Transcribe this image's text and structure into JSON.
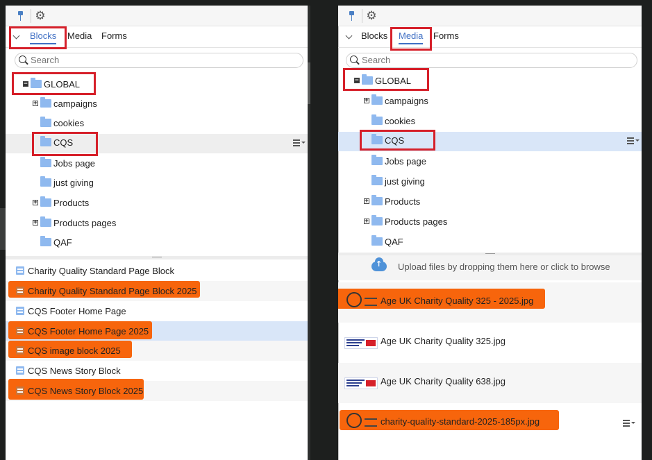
{
  "left": {
    "tabs": [
      "Blocks",
      "Media",
      "Forms"
    ],
    "search_placeholder": "Search",
    "tree": {
      "root": "GLOBAL",
      "items": [
        "campaigns",
        "cookies",
        "CQS",
        "Jobs page",
        "just giving",
        "Products",
        "Products pages",
        "QAF"
      ]
    },
    "blocks": [
      "Charity Quality Standard Page Block",
      "Charity Quality Standard Page Block 2025",
      "CQS Footer Home Page",
      "CQS Footer Home Page 2025",
      "CQS image block 2025",
      "CQS News Story Block",
      "CQS News Story Block 2025"
    ]
  },
  "right": {
    "tabs": [
      "Blocks",
      "Media",
      "Forms"
    ],
    "search_placeholder": "Search",
    "tree": {
      "root": "GLOBAL",
      "items": [
        "campaigns",
        "cookies",
        "CQS",
        "Jobs page",
        "just giving",
        "Products",
        "Products pages",
        "QAF"
      ]
    },
    "upload_text": "Upload files by dropping them here or click to browse",
    "media": [
      "Age UK Charity Quality 325 - 2025.jpg",
      "Age UK Charity Quality 325.jpg",
      "Age UK Charity Quality 638.jpg",
      "charity-quality-standard-2025-185px.jpg"
    ]
  },
  "colors": {
    "accent": "#3f6fc4",
    "highlight": "#f7650c",
    "annotation_box": "#d6202a",
    "folder": "#8fb9ef",
    "selection": "#d9e6f8"
  }
}
